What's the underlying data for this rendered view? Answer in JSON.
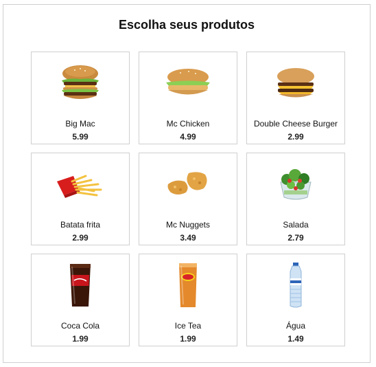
{
  "title": "Escolha seus produtos",
  "products": [
    {
      "name": "Big Mac",
      "price": "5.99",
      "icon": "big-mac-icon"
    },
    {
      "name": "Mc Chicken",
      "price": "4.99",
      "icon": "mc-chicken-icon"
    },
    {
      "name": "Double Cheese Burger",
      "price": "2.99",
      "icon": "double-cheese-burger-icon"
    },
    {
      "name": "Batata frita",
      "price": "2.99",
      "icon": "french-fries-icon"
    },
    {
      "name": "Mc Nuggets",
      "price": "3.49",
      "icon": "nuggets-icon"
    },
    {
      "name": "Salada",
      "price": "2.79",
      "icon": "salad-icon"
    },
    {
      "name": "Coca Cola",
      "price": "1.99",
      "icon": "cola-glass-icon"
    },
    {
      "name": "Ice Tea",
      "price": "1.99",
      "icon": "ice-tea-glass-icon"
    },
    {
      "name": "Água",
      "price": "1.49",
      "icon": "water-bottle-icon"
    }
  ]
}
